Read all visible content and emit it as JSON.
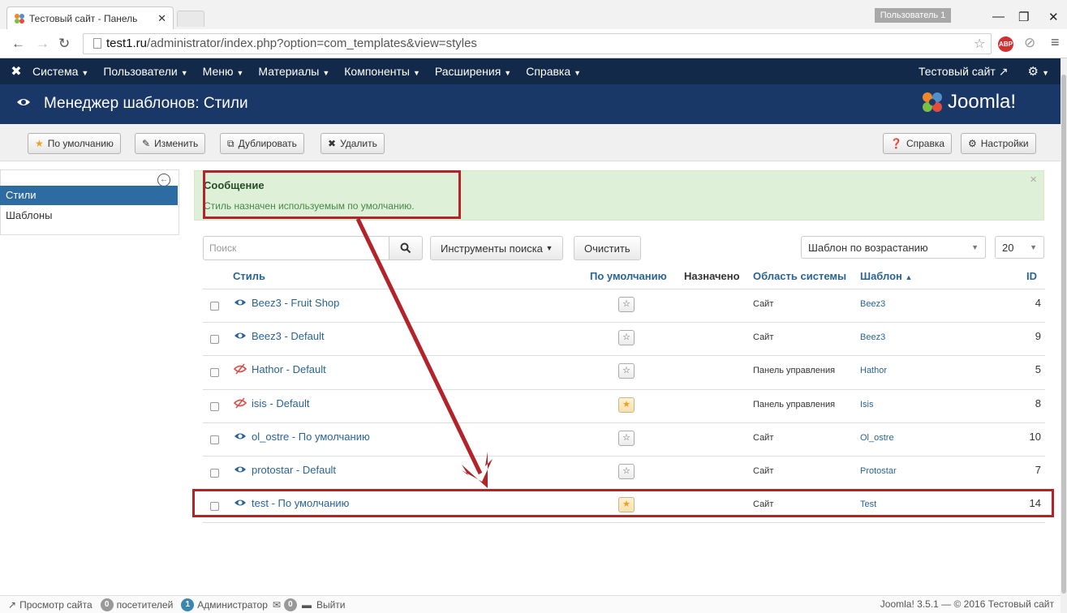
{
  "browser": {
    "tab_title": "Тестовый сайт - Панель",
    "user_badge": "Пользователь 1",
    "url_host": "test1.ru",
    "url_path": "/administrator/index.php?option=com_templates&view=styles",
    "abp_label": "ABP"
  },
  "joomla_nav": {
    "items": [
      {
        "label": "Система"
      },
      {
        "label": "Пользователи"
      },
      {
        "label": "Меню"
      },
      {
        "label": "Материалы"
      },
      {
        "label": "Компоненты"
      },
      {
        "label": "Расширения"
      },
      {
        "label": "Справка"
      }
    ],
    "site_link": "Тестовый сайт"
  },
  "header": {
    "title": "Менеджер шаблонов: Стили",
    "brand": "Joomla!"
  },
  "toolbar": {
    "default_label": "По умолчанию",
    "edit_label": "Изменить",
    "duplicate_label": "Дублировать",
    "delete_label": "Удалить",
    "help_label": "Справка",
    "options_label": "Настройки"
  },
  "sidebar": {
    "items": [
      {
        "label": "Стили",
        "active": true
      },
      {
        "label": "Шаблоны",
        "active": false
      }
    ]
  },
  "message": {
    "heading": "Сообщение",
    "text": "Стиль назначен используемым по умолчанию."
  },
  "filters": {
    "search_placeholder": "Поиск",
    "search_tools_label": "Инструменты поиска",
    "clear_label": "Очистить",
    "sort_value": "Шаблон по возрастанию",
    "limit_value": "20"
  },
  "table": {
    "headers": {
      "style": "Стиль",
      "default": "По умолчанию",
      "assigned": "Назначено",
      "client": "Область системы",
      "template": "Шаблон",
      "id": "ID"
    },
    "rows": [
      {
        "name": "Beez3 - Fruit Shop",
        "area": "Сайт",
        "template": "Beez3",
        "id": "4",
        "default": false,
        "site_style": true
      },
      {
        "name": "Beez3 - Default",
        "area": "Сайт",
        "template": "Beez3",
        "id": "9",
        "default": false,
        "site_style": true
      },
      {
        "name": "Hathor - Default",
        "area": "Панель управления",
        "template": "Hathor",
        "id": "5",
        "default": false,
        "site_style": false
      },
      {
        "name": "isis - Default",
        "area": "Панель управления",
        "template": "Isis",
        "id": "8",
        "default": true,
        "site_style": false
      },
      {
        "name": "ol_ostre - По умолчанию",
        "area": "Сайт",
        "template": "Ol_ostre",
        "id": "10",
        "default": false,
        "site_style": true
      },
      {
        "name": "protostar - Default",
        "area": "Сайт",
        "template": "Protostar",
        "id": "7",
        "default": false,
        "site_style": true
      },
      {
        "name": "test - По умолчанию",
        "area": "Сайт",
        "template": "Test",
        "id": "14",
        "default": true,
        "site_style": true
      }
    ]
  },
  "footer": {
    "view_site": "Просмотр сайта",
    "visitors_count": "0",
    "visitors_label": "посетителей",
    "admins_count": "1",
    "admins_label": "Администратор",
    "messages_count": "0",
    "logout": "Выйти",
    "copyright": "Joomla! 3.5.1 — © 2016 Тестовый сайт"
  },
  "colors": {
    "nav_bg": "#13294a",
    "header_bg": "#1a3867",
    "accent_link": "#2a6496",
    "alert_bg": "#dff0d8",
    "highlight": "#b2232a",
    "star_on": "#f0a020"
  }
}
